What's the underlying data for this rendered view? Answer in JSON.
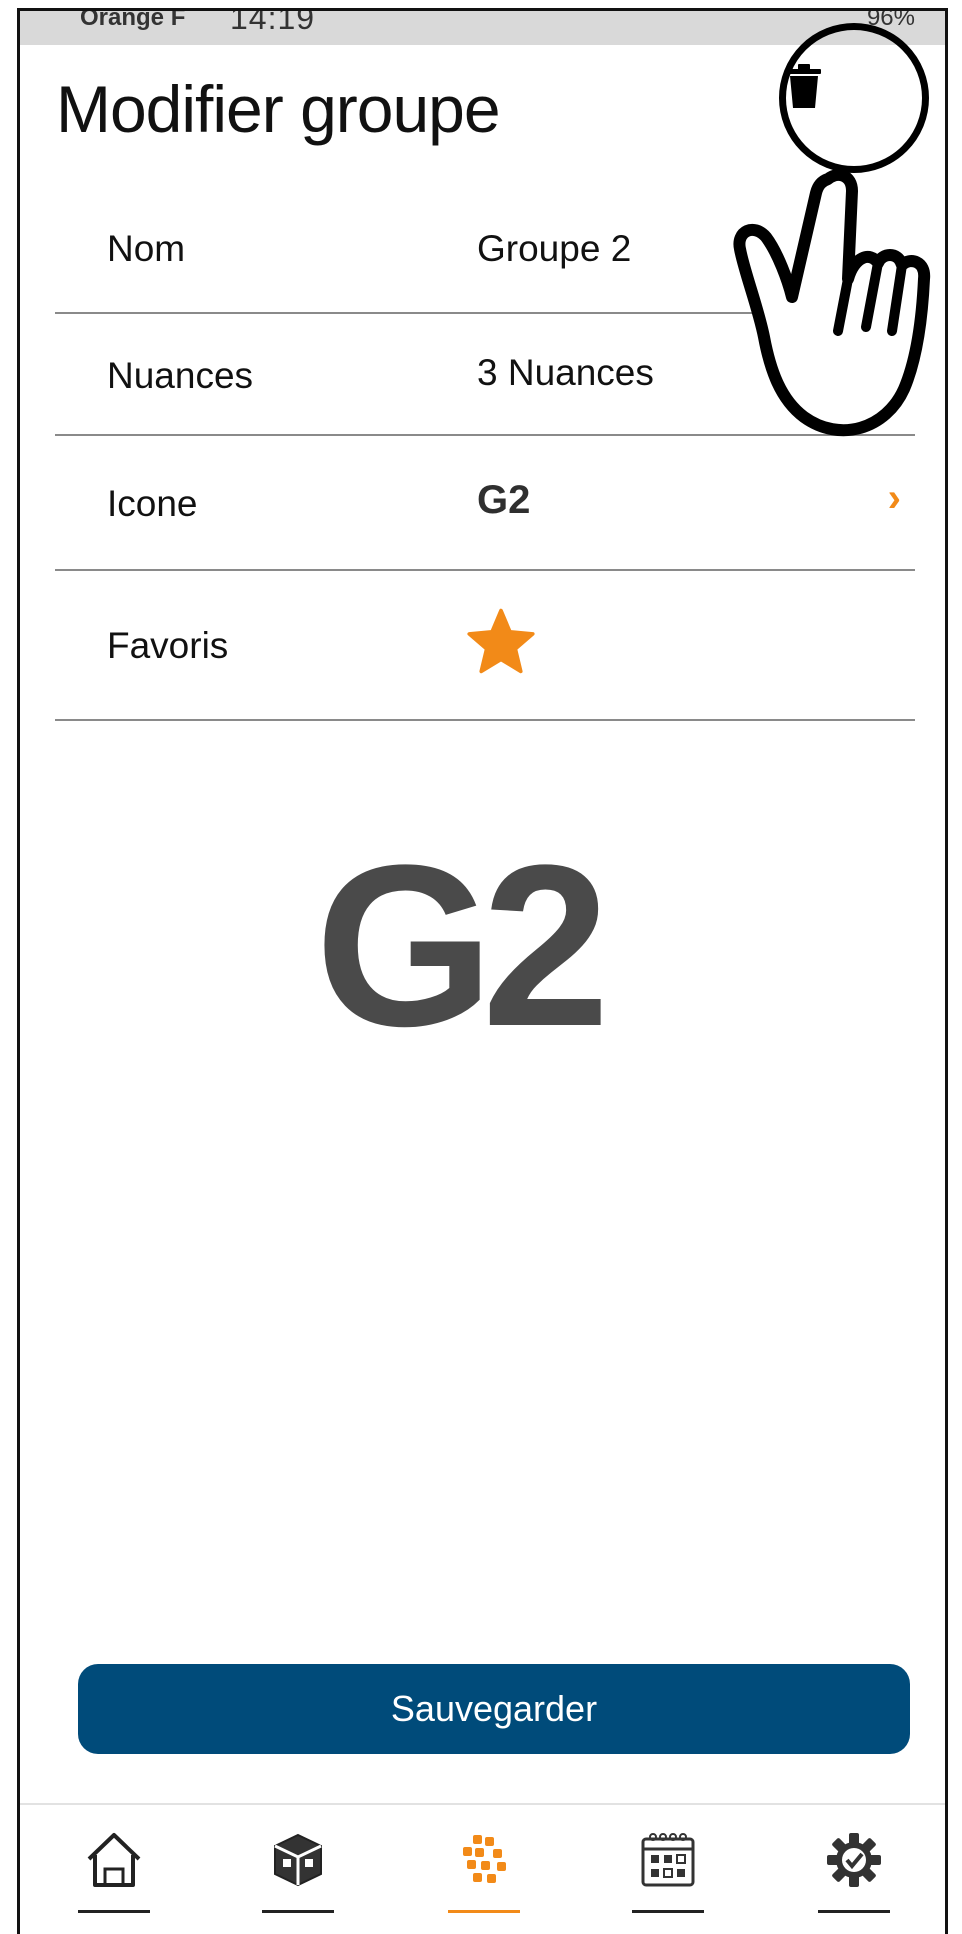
{
  "status_bar": {
    "carrier": "Orange F",
    "time": "14:19",
    "right_indicators": "96%"
  },
  "header": {
    "title": "Modifier groupe",
    "delete_icon": "trash-icon"
  },
  "rows": [
    {
      "label": "Nom",
      "value": "Groupe 2"
    },
    {
      "label": "Nuances",
      "value": "3 Nuances"
    },
    {
      "label": "Icone",
      "value": "G2"
    },
    {
      "label": "Favoris",
      "value": ""
    }
  ],
  "preview": {
    "icon_text": "G2"
  },
  "save_button": {
    "label": "Sauvegarder"
  },
  "bottom_nav": [
    {
      "icon": "home-icon",
      "active": false
    },
    {
      "icon": "cube-icon",
      "active": false
    },
    {
      "icon": "groups-icon",
      "active": true
    },
    {
      "icon": "calendar-icon",
      "active": false
    },
    {
      "icon": "settings-icon",
      "active": false
    }
  ],
  "colors": {
    "accent": "#f28a18",
    "primary_button": "#004b7a",
    "icon_dark": "#4a4a4a"
  }
}
